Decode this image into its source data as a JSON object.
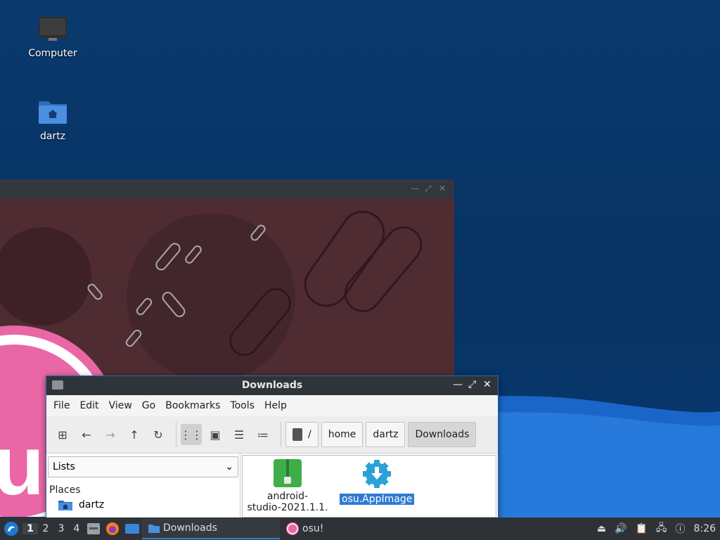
{
  "desktop": {
    "icons": [
      {
        "label": "Computer",
        "icon": "computer-icon"
      },
      {
        "label": "dartz",
        "icon": "home-folder-icon"
      }
    ]
  },
  "osu_window": {
    "title": ""
  },
  "file_manager": {
    "title": "Downloads",
    "menu": [
      "File",
      "Edit",
      "View",
      "Go",
      "Bookmarks",
      "Tools",
      "Help"
    ],
    "toolbar": {
      "icons": [
        "new-tab-icon",
        "back-icon",
        "forward-icon",
        "up-icon",
        "reload-icon",
        "icon-view-icon",
        "thumbnail-view-icon",
        "compact-view-icon",
        "detailed-list-icon"
      ]
    },
    "path": [
      "/",
      "home",
      "dartz",
      "Downloads"
    ],
    "side_pane": {
      "mode": "Lists",
      "places_heading": "Places",
      "places": [
        {
          "label": "dartz",
          "icon": "home-folder-icon"
        }
      ]
    },
    "files": [
      {
        "name": "android-studio-2021.1.1.…",
        "name_line1": "android-",
        "name_line2": "studio-2021.1.1.",
        "icon": "zip-archive-icon",
        "selected": false
      },
      {
        "name": "osu.AppImage",
        "icon": "download-gear-icon",
        "selected": true
      }
    ]
  },
  "taskbar": {
    "workspaces": [
      "1",
      "2",
      "3",
      "4"
    ],
    "current_workspace": "1",
    "tasks": [
      {
        "label": "Downloads",
        "icon": "folder-icon",
        "active": true
      },
      {
        "label": "osu!",
        "icon": "osu-icon",
        "active": false
      }
    ],
    "clock": "8:26"
  }
}
